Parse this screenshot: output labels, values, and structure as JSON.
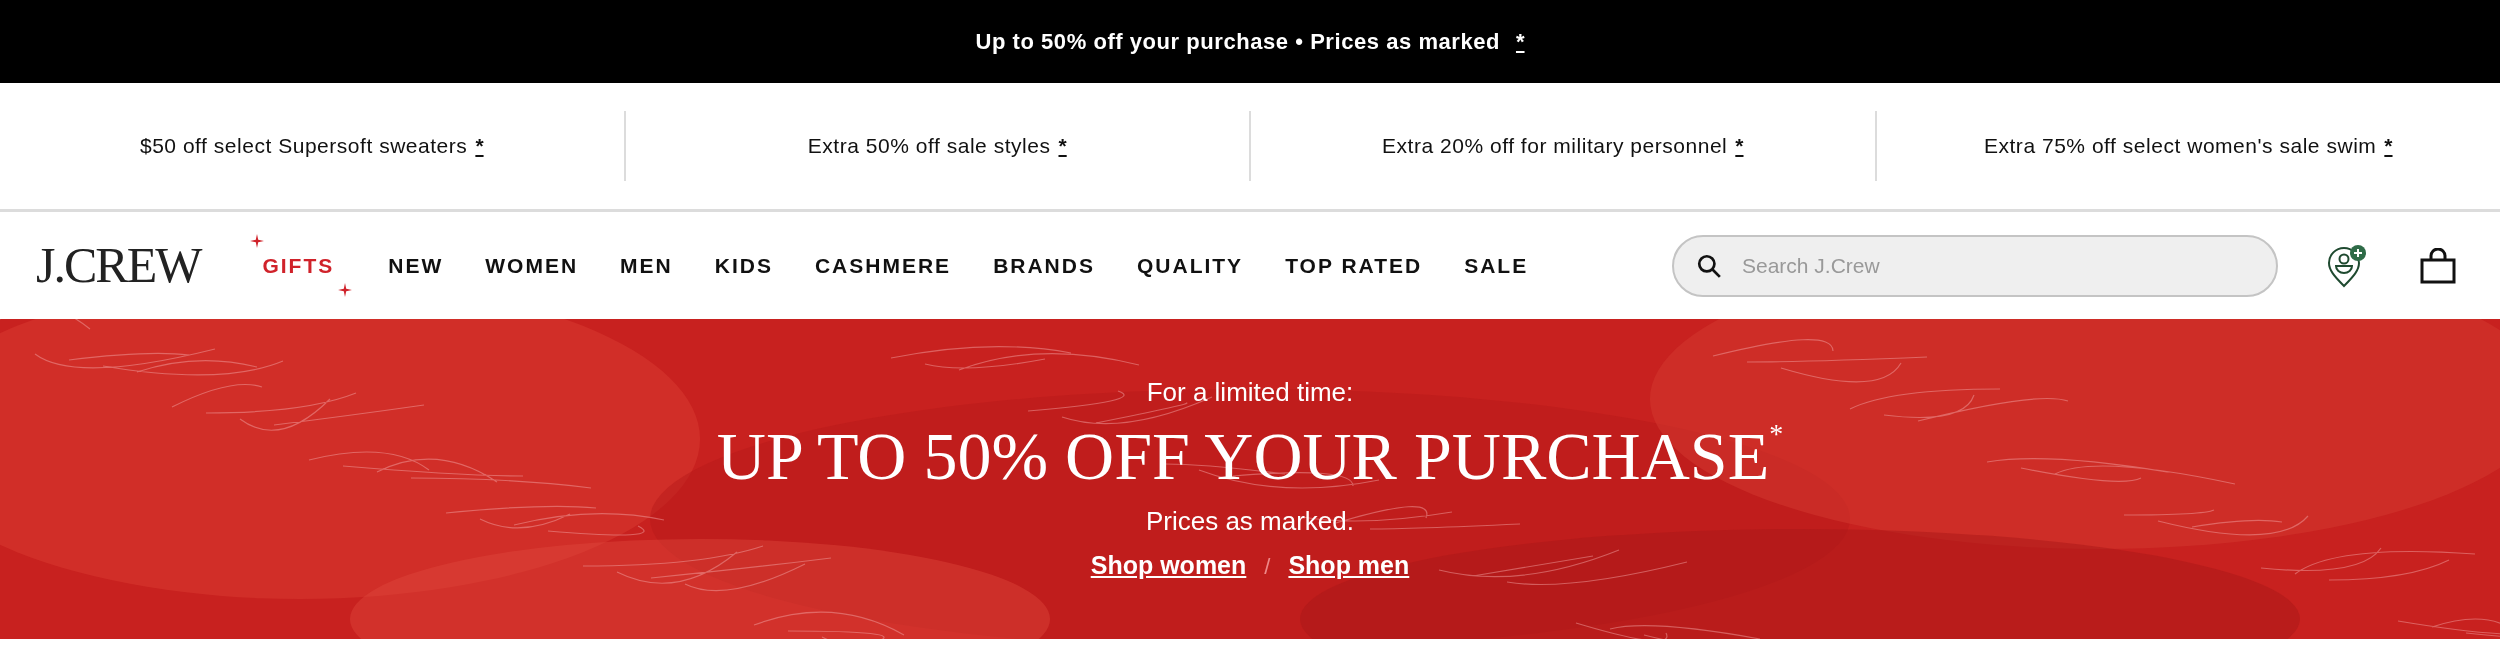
{
  "announcement": {
    "text": "Up to 50% off your purchase • Prices as marked",
    "mark": "*"
  },
  "promos": [
    {
      "text": "$50 off select Supersoft sweaters",
      "mark": "*"
    },
    {
      "text": "Extra 50% off sale styles",
      "mark": "*"
    },
    {
      "text": "Extra 20% off for military personnel",
      "mark": "*"
    },
    {
      "text": "Extra 75% off select women's sale swim",
      "mark": "*"
    }
  ],
  "header": {
    "logo": "J.CREW",
    "nav": [
      {
        "label": "GIFTS",
        "kind": "featured"
      },
      {
        "label": "NEW",
        "kind": "plain"
      },
      {
        "label": "WOMEN",
        "kind": "plain"
      },
      {
        "label": "MEN",
        "kind": "plain"
      },
      {
        "label": "KIDS",
        "kind": "plain"
      },
      {
        "label": "CASHMERE",
        "kind": "plain"
      },
      {
        "label": "BRANDS",
        "kind": "plain"
      },
      {
        "label": "QUALITY",
        "kind": "plain"
      },
      {
        "label": "TOP RATED",
        "kind": "plain"
      },
      {
        "label": "SALE",
        "kind": "plain"
      }
    ],
    "search": {
      "placeholder": "Search J.Crew"
    }
  },
  "hero": {
    "kicker": "For a limited time:",
    "headline": "UP TO 50% OFF YOUR PURCHASE",
    "headline_mark": "*",
    "subtitle": "Prices as marked.",
    "links": [
      "Shop women",
      "Shop men"
    ],
    "separator": "/"
  }
}
